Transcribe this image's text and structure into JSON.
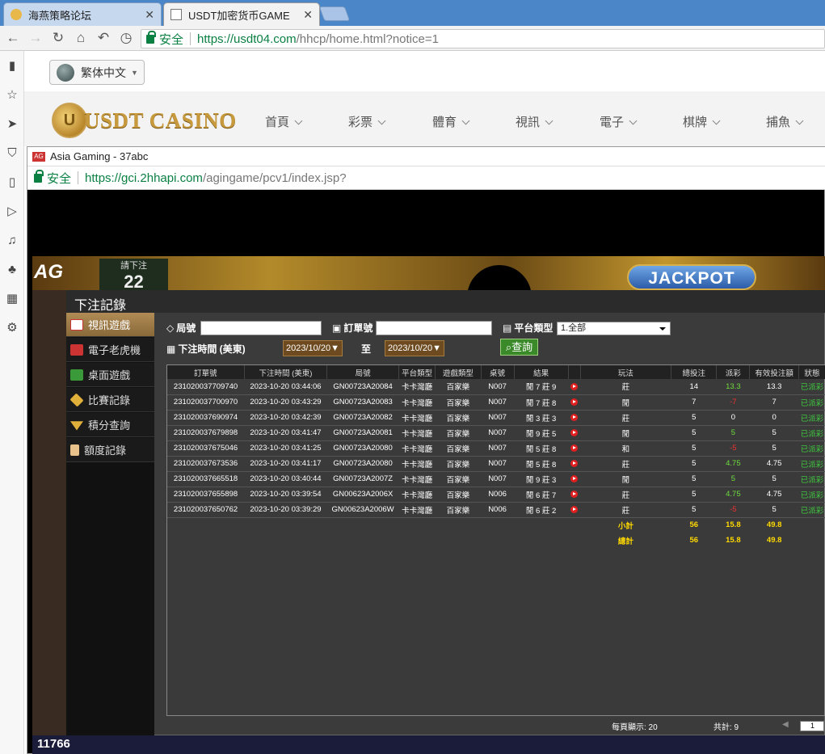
{
  "browser": {
    "tabs": [
      {
        "title": "海燕策略论坛",
        "active": false
      },
      {
        "title": "USDT加密货币GAME",
        "active": true
      }
    ],
    "secure_label": "安全",
    "url_host": "https://usdt04.com",
    "url_path": "/hhcp/home.html?notice=1"
  },
  "site": {
    "language": "繁体中文",
    "logo_text": "USDT CASINO",
    "nav": [
      "首頁",
      "彩票",
      "體育",
      "視訊",
      "電子",
      "棋牌",
      "捕魚"
    ]
  },
  "popup": {
    "title": "Asia Gaming - 37abc",
    "secure_label": "安全",
    "url_host": "https://gci.2hhapi.com",
    "url_path": "/agingame/pcv1/index.jsp?"
  },
  "game": {
    "ag_logo": "AG",
    "bet_prompt": "請下注",
    "countdown": "22",
    "jackpot": "JACKPOT",
    "online_count": "11766"
  },
  "records": {
    "title": "下注記錄",
    "menu": [
      "視訊遊戲",
      "電子老虎機",
      "桌面遊戲",
      "比賽記錄",
      "積分查詢",
      "額度記錄"
    ],
    "filters": {
      "round_label": "局號",
      "order_label": "訂單號",
      "platform_label": "平台類型",
      "platform_value": "1.全部",
      "time_label": "下注時間 (美東)",
      "date_from": "2023/10/20",
      "to_label": "至",
      "date_to": "2023/10/20",
      "query_button": "查詢"
    },
    "columns": [
      "訂單號",
      "下注時間 (美東)",
      "局號",
      "平台類型",
      "遊戲類型",
      "桌號",
      "結果",
      "",
      "玩法",
      "總投注",
      "派彩",
      "有效投注額",
      "狀態"
    ],
    "rows": [
      {
        "order": "231020037709740",
        "time": "2023-10-20 03:44:06",
        "round": "GN00723A20084",
        "platform": "卡卡灣廳",
        "game": "百家樂",
        "table": "N007",
        "result": "閒 7 莊 9",
        "play": "莊",
        "bet": "14",
        "payout": "13.3",
        "payout_color": "g",
        "valid": "13.3",
        "status": "已派彩"
      },
      {
        "order": "231020037700970",
        "time": "2023-10-20 03:43:29",
        "round": "GN00723A20083",
        "platform": "卡卡灣廳",
        "game": "百家樂",
        "table": "N007",
        "result": "閒 7 莊 8",
        "play": "閒",
        "bet": "7",
        "payout": "-7",
        "payout_color": "r",
        "valid": "7",
        "status": "已派彩"
      },
      {
        "order": "231020037690974",
        "time": "2023-10-20 03:42:39",
        "round": "GN00723A20082",
        "platform": "卡卡灣廳",
        "game": "百家樂",
        "table": "N007",
        "result": "閒 3 莊 3",
        "play": "莊",
        "bet": "5",
        "payout": "0",
        "payout_color": "w",
        "valid": "0",
        "status": "已派彩"
      },
      {
        "order": "231020037679898",
        "time": "2023-10-20 03:41:47",
        "round": "GN00723A20081",
        "platform": "卡卡灣廳",
        "game": "百家樂",
        "table": "N007",
        "result": "閒 9 莊 5",
        "play": "閒",
        "bet": "5",
        "payout": "5",
        "payout_color": "g",
        "valid": "5",
        "status": "已派彩"
      },
      {
        "order": "231020037675046",
        "time": "2023-10-20 03:41:25",
        "round": "GN00723A20080",
        "platform": "卡卡灣廳",
        "game": "百家樂",
        "table": "N007",
        "result": "閒 5 莊 8",
        "play": "和",
        "bet": "5",
        "payout": "-5",
        "payout_color": "r",
        "valid": "5",
        "status": "已派彩"
      },
      {
        "order": "231020037673536",
        "time": "2023-10-20 03:41:17",
        "round": "GN00723A20080",
        "platform": "卡卡灣廳",
        "game": "百家樂",
        "table": "N007",
        "result": "閒 5 莊 8",
        "play": "莊",
        "bet": "5",
        "payout": "4.75",
        "payout_color": "g",
        "valid": "4.75",
        "status": "已派彩"
      },
      {
        "order": "231020037665518",
        "time": "2023-10-20 03:40:44",
        "round": "GN00723A2007Z",
        "platform": "卡卡灣廳",
        "game": "百家樂",
        "table": "N007",
        "result": "閒 9 莊 3",
        "play": "閒",
        "bet": "5",
        "payout": "5",
        "payout_color": "g",
        "valid": "5",
        "status": "已派彩"
      },
      {
        "order": "231020037655898",
        "time": "2023-10-20 03:39:54",
        "round": "GN00623A2006X",
        "platform": "卡卡灣廳",
        "game": "百家樂",
        "table": "N006",
        "result": "閒 6 莊 7",
        "play": "莊",
        "bet": "5",
        "payout": "4.75",
        "payout_color": "g",
        "valid": "4.75",
        "status": "已派彩"
      },
      {
        "order": "231020037650762",
        "time": "2023-10-20 03:39:29",
        "round": "GN00623A2006W",
        "platform": "卡卡灣廳",
        "game": "百家樂",
        "table": "N006",
        "result": "閒 6 莊 2",
        "play": "莊",
        "bet": "5",
        "payout": "-5",
        "payout_color": "r",
        "valid": "5",
        "status": "已派彩"
      }
    ],
    "subtotal": {
      "label": "小計",
      "bet": "56",
      "payout": "15.8",
      "valid": "49.8"
    },
    "total": {
      "label": "總計",
      "bet": "56",
      "payout": "15.8",
      "valid": "49.8"
    },
    "per_page": "每頁顯示: 20",
    "total_count": "共計: 9",
    "page": "1"
  }
}
